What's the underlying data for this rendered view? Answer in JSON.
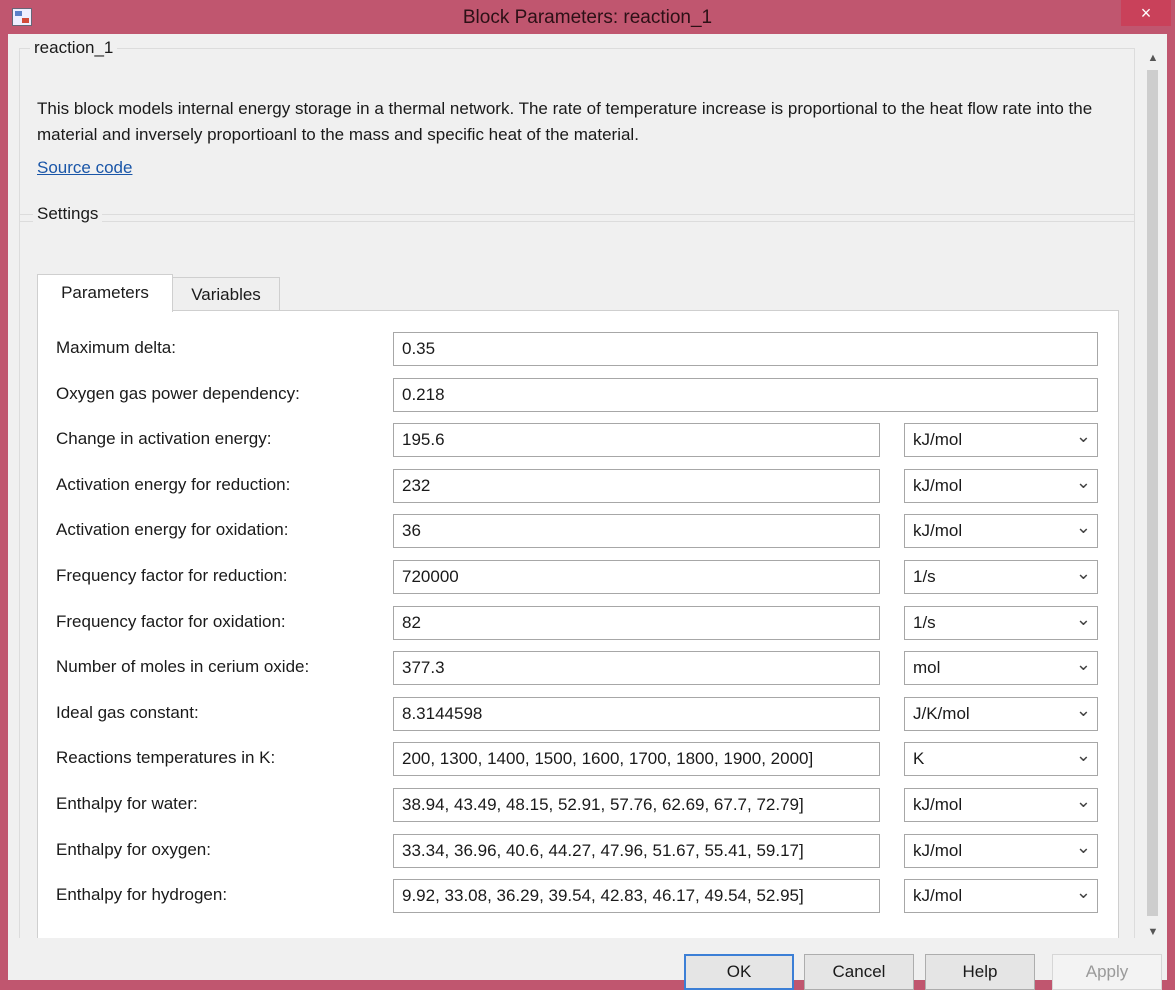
{
  "window": {
    "title": "Block Parameters: reaction_1",
    "close_label": "×"
  },
  "block": {
    "name": "reaction_1",
    "description": "This block models internal energy storage in a thermal network. The rate of temperature increase is proportional to the heat flow rate into the material and inversely proportioanl to the mass and specific heat of the material.",
    "source_link": "Source code"
  },
  "settings": {
    "label": "Settings",
    "tabs": [
      "Parameters",
      "Variables"
    ],
    "active_tab": "Parameters"
  },
  "parameters": [
    {
      "label": "Maximum delta:",
      "value": "0.35",
      "unit": ""
    },
    {
      "label": "Oxygen gas power dependency:",
      "value": "0.218",
      "unit": ""
    },
    {
      "label": "Change in activation energy:",
      "value": "195.6",
      "unit": "kJ/mol"
    },
    {
      "label": "Activation energy for reduction:",
      "value": "232",
      "unit": "kJ/mol"
    },
    {
      "label": "Activation energy for oxidation:",
      "value": "36",
      "unit": "kJ/mol"
    },
    {
      "label": "Frequency factor for reduction:",
      "value": "720000",
      "unit": "1/s"
    },
    {
      "label": "Frequency factor for oxidation:",
      "value": "82",
      "unit": "1/s"
    },
    {
      "label": "Number of moles in cerium oxide:",
      "value": "377.3",
      "unit": "mol"
    },
    {
      "label": "Ideal gas constant:",
      "value": "8.3144598",
      "unit": "J/K/mol"
    },
    {
      "label": "Reactions temperatures in K:",
      "value": "200, 1300, 1400, 1500, 1600, 1700, 1800, 1900, 2000]",
      "unit": "K"
    },
    {
      "label": "Enthalpy for water:",
      "value": "38.94, 43.49, 48.15, 52.91, 57.76, 62.69, 67.7, 72.79]",
      "unit": "kJ/mol"
    },
    {
      "label": "Enthalpy for oxygen:",
      "value": "33.34, 36.96, 40.6, 44.27, 47.96, 51.67, 55.41, 59.17]",
      "unit": "kJ/mol"
    },
    {
      "label": "Enthalpy for hydrogen:",
      "value": "9.92, 33.08, 36.29, 39.54, 42.83, 46.17, 49.54, 52.95]",
      "unit": "kJ/mol"
    }
  ],
  "buttons": {
    "ok": "OK",
    "cancel": "Cancel",
    "help": "Help",
    "apply": "Apply"
  }
}
